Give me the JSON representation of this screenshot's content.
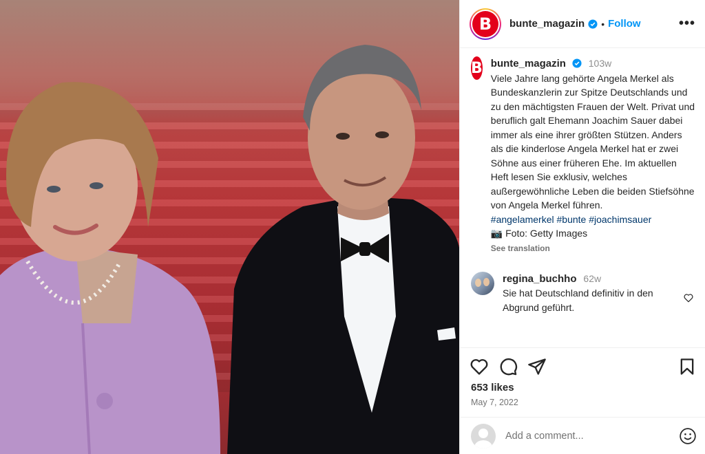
{
  "post": {
    "account": "bunte_magazin",
    "follow_label": "Follow",
    "logo_letter": "B",
    "more_label": "•••"
  },
  "caption": {
    "username": "bunte_magazin",
    "age": "103w",
    "text": "Viele Jahre lang gehörte Angela Merkel als Bundeskanzlerin zur Spitze Deutschlands und zu den mächtigsten Frauen der Welt. Privat und beruflich galt Ehemann Joachim Sauer dabei immer als eine ihrer größten Stützen. Anders als die kinderlose Angela Merkel hat er zwei Söhne aus einer früheren Ehe. Im aktuellen Heft lesen Sie exklusiv, welches außergewöhnliche Leben die beiden Stiefsöhne von Angela Merkel führen.",
    "hashtags": "#angelamerkel #bunte #joachimsauer",
    "credit": "📷 Foto: Getty Images",
    "see_translation": "See translation"
  },
  "comment": {
    "username": "regina_buchho",
    "age": "62w",
    "text": "Sie hat Deutschland definitiv in den Abgrund geführt."
  },
  "stats": {
    "likes": "653 likes",
    "date": "May 7, 2022"
  },
  "composer": {
    "placeholder": "Add a comment..."
  },
  "colors": {
    "follow": "#0095f6",
    "brand": "#e3001b",
    "hashtag": "#00376b"
  }
}
